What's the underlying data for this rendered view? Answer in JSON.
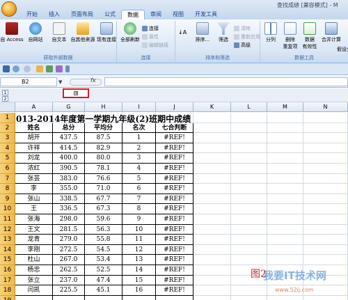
{
  "window": {
    "title": "查找成绩 [兼容模式] - M"
  },
  "tabs": [
    "开始",
    "插入",
    "页面布局",
    "公式",
    "数据",
    "审阅",
    "视图",
    "开发工具"
  ],
  "active_tab": "数据",
  "ribbon": {
    "get_external": {
      "label": "获取外部数据",
      "access": "自 Access",
      "web": "自网站",
      "text": "自文本",
      "other": "自其他来源",
      "existing": "现有连接"
    },
    "connections": {
      "label": "连接",
      "refresh_all": "全部刷新",
      "connections": "连接",
      "properties": "属性",
      "edit_links": "编辑链接"
    },
    "sort_filter": {
      "label": "排序和筛选",
      "sort": "排序...",
      "filter": "筛选",
      "clear": "清除",
      "reapply": "重新应用",
      "advanced": "高级"
    },
    "data_tools": {
      "label": "数据工具",
      "split": "分列",
      "remove_dup": "删除\n重复项",
      "validation": "数据\n有效性",
      "consolidate": "合并计算",
      "whatif": "假设分析"
    }
  },
  "namebox": {
    "value": "B2"
  },
  "fx_label": "fx",
  "outline_levels": [
    "1",
    "2"
  ],
  "collapse_symbol": "+",
  "columns": [
    "A",
    "G",
    "H",
    "I",
    "J",
    "K",
    "L",
    "M",
    "N"
  ],
  "row_numbers": [
    "1",
    "2",
    "3",
    "4",
    "5",
    "6",
    "7",
    "8",
    "9",
    "10",
    "11",
    "12",
    "13",
    "14",
    "15",
    "16",
    "17",
    "18",
    "19"
  ],
  "sheet_title": "013-2014年度第一学期九年级(2)班期中成绩",
  "table_headers": [
    "姓名",
    "总分",
    "平均分",
    "名次",
    "七合判断"
  ],
  "rows": [
    [
      "胡开",
      "437.5",
      "87.5",
      "1",
      "#REF!"
    ],
    [
      "许祥",
      "414.5",
      "82.9",
      "2",
      "#REF!"
    ],
    [
      "刘龙",
      "400.0",
      "80.0",
      "3",
      "#REF!"
    ],
    [
      "浓红",
      "390.5",
      "78.1",
      "4",
      "#REF!"
    ],
    [
      "张芸",
      "383.0",
      "76.6",
      "5",
      "#REF!"
    ],
    [
      "李",
      "355.0",
      "71.0",
      "6",
      "#REF!"
    ],
    [
      "张山",
      "338.5",
      "67.7",
      "7",
      "#REF!"
    ],
    [
      "王",
      "336.5",
      "67.3",
      "8",
      "#REF!"
    ],
    [
      "张海",
      "298.0",
      "59.6",
      "9",
      "#REF!"
    ],
    [
      "王文",
      "281.5",
      "56.3",
      "10",
      "#REF!"
    ],
    [
      "龙青",
      "279.0",
      "55.8",
      "11",
      "#REF!"
    ],
    [
      "李刚",
      "272.5",
      "54.5",
      "12",
      "#REF!"
    ],
    [
      "杜山",
      "267.0",
      "53.4",
      "13",
      "#REF!"
    ],
    [
      "杨忠",
      "262.5",
      "52.5",
      "14",
      "#REF!"
    ],
    [
      "张立",
      "237.0",
      "47.4",
      "15",
      "#REF!"
    ],
    [
      "闫凯",
      "225.5",
      "45.1",
      "16",
      "#REF!"
    ]
  ],
  "watermark": {
    "fig": "图2",
    "brand": "我要IT技术网",
    "url": "www.52ij.com"
  },
  "colors": {
    "row_header": "#f0b94a",
    "highlight": "#d0202a"
  }
}
